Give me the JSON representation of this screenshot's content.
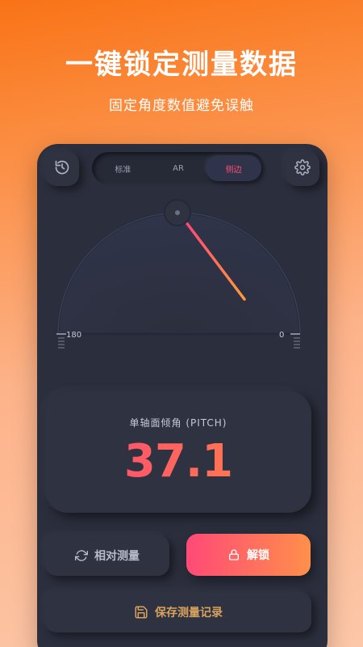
{
  "promo": {
    "title": "一键锁定测量数据",
    "subtitle": "固定角度数值避免误触"
  },
  "header": {
    "tabs": [
      {
        "label": "标准",
        "active": false
      },
      {
        "label": "AR",
        "active": false
      },
      {
        "label": "侧边",
        "active": true
      }
    ]
  },
  "gauge": {
    "left_label": "180",
    "right_label": "0",
    "needle_angle_deg": 37.1
  },
  "reading": {
    "label": "单轴面倾角 (PITCH)",
    "value": "37.1"
  },
  "actions": {
    "relative_label": "相对测量",
    "unlock_label": "解锁",
    "save_label": "保存测量记录"
  },
  "colors": {
    "accent_start": "#ff3f7a",
    "accent_end": "#ff8c42",
    "panel": "#2b2f3d",
    "save_text": "#d8a15e"
  },
  "icons": {
    "history": "history-icon",
    "settings": "gear-icon",
    "relative": "refresh-icon",
    "unlock": "lock-icon",
    "save": "save-icon"
  }
}
